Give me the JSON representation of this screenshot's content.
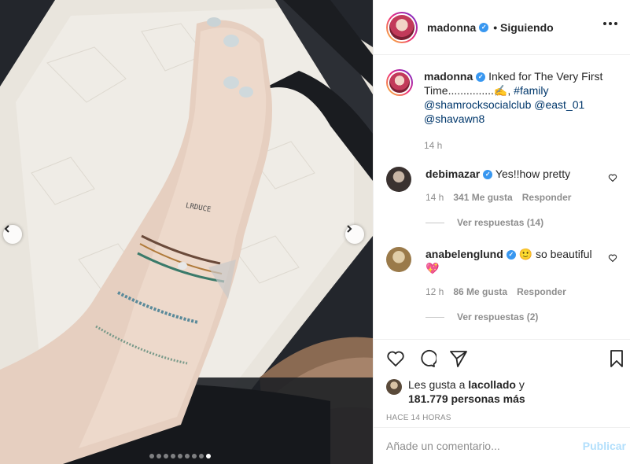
{
  "post": {
    "username": "madonna",
    "follow_state": "• Siguiendo",
    "verified_mark": "✓"
  },
  "caption": {
    "username": "madonna",
    "text_before": " Inked for The Very First Time...............✍️, ",
    "hashtag": "#family",
    "mention_1": "@shamrocksocialclub",
    "mention_2": "@east_01",
    "mention_3": "@shavawn8",
    "time": "14 h"
  },
  "comments": [
    {
      "username": "debimazar",
      "text": " Yes!!how pretty",
      "time": "14 h",
      "likes": "341 Me gusta",
      "reply": "Responder",
      "view_replies": "Ver respuestas (14)"
    },
    {
      "username": "anabelenglund",
      "text": " 🙂 so beautiful",
      "emoji_line": "💖",
      "time": "12 h",
      "likes": "86 Me gusta",
      "reply": "Responder",
      "view_replies": "Ver respuestas (2)"
    }
  ],
  "likes_line": {
    "prefix": "Les gusta a ",
    "user": "lacollado",
    "suffix": " y",
    "count_line": "181.779 personas más"
  },
  "timestamp": "HACE 14 HORAS",
  "add_comment": {
    "placeholder": "Añade un comentario...",
    "publish": "Publicar"
  },
  "carousel": {
    "total": 9,
    "active_index": 8
  },
  "colors": {
    "link": "#00376b",
    "verified": "#3897f0",
    "publish_disabled": "#b2dffc"
  }
}
